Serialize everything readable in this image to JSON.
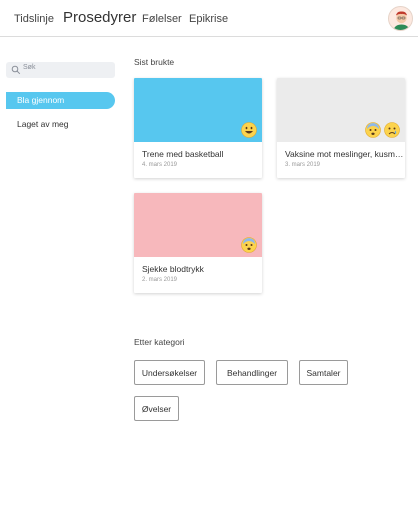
{
  "nav": {
    "items": [
      {
        "label": "Tidslinje"
      },
      {
        "label": "Prosedyrer"
      },
      {
        "label": "Følelser"
      },
      {
        "label": "Epikrise"
      }
    ]
  },
  "sidebar": {
    "search_placeholder": "Søk",
    "items": [
      {
        "label": "Bla gjennom"
      },
      {
        "label": "Laget av meg"
      }
    ]
  },
  "recent": {
    "title": "Sist brukte",
    "cards": [
      {
        "title": "Trene med basketball",
        "date": "4. mars 2019",
        "color": "#57c7ef",
        "emojis": [
          "grinning-face-icon"
        ]
      },
      {
        "title": "Vaksine mot meslinger, kusm…",
        "date": "3. mars 2019",
        "color": "#ebebeb",
        "emojis": [
          "anxious-face-icon",
          "sad-face-icon"
        ]
      },
      {
        "title": "Sjekke blodtrykk",
        "date": "2. mars 2019",
        "color": "#f7b8bc",
        "emojis": [
          "anxious-face-icon"
        ]
      }
    ]
  },
  "categories": {
    "title": "Etter kategori",
    "items": [
      {
        "label": "Undersøkelser"
      },
      {
        "label": "Behandlinger"
      },
      {
        "label": "Samtaler"
      },
      {
        "label": "Øvelser"
      }
    ]
  },
  "colors": {
    "accent": "#57c7ef",
    "pink": "#f7b8bc",
    "grey_card": "#ebebeb"
  }
}
